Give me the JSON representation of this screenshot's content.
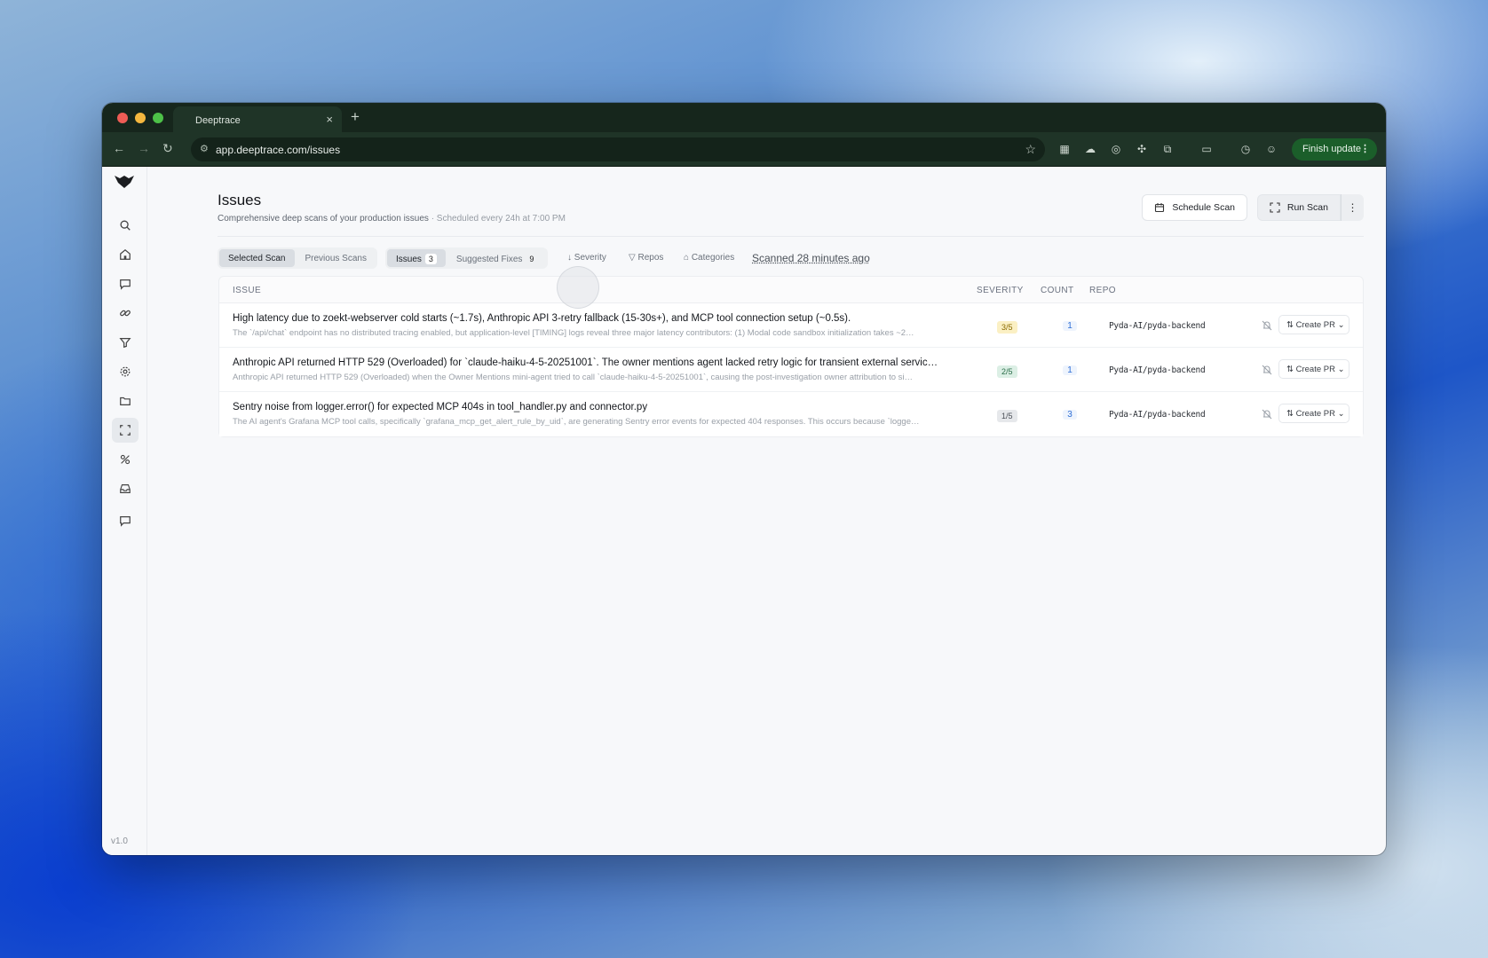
{
  "browser": {
    "tab_title": "Deeptrace",
    "url": "app.deeptrace.com/issues",
    "finish_update_label": "Finish update",
    "new_tab_glyph": "+",
    "close_glyph": "×"
  },
  "app": {
    "version": "v1.0"
  },
  "header": {
    "title": "Issues",
    "subtitle": "Comprehensive deep scans of your production issues",
    "schedule_note": "· Scheduled every 24h at 7:00 PM",
    "schedule_button": "Schedule Scan",
    "run_button": "Run Scan"
  },
  "filters": {
    "scan_tabs": [
      "Selected Scan",
      "Previous Scans"
    ],
    "issues_label": "Issues",
    "issues_count": "3",
    "fixes_label": "Suggested Fixes",
    "fixes_count": "9",
    "severity_label": "↓ Severity",
    "repos_label": "Repos",
    "categories_label": "Categories",
    "scanned_label": "Scanned 28 minutes ago"
  },
  "table": {
    "columns": [
      "ISSUE",
      "SEVERITY",
      "COUNT",
      "REPO"
    ],
    "rows": [
      {
        "title": "High latency due to zoekt-webserver cold starts (~1.7s), Anthropic API 3-retry fallback (15-30s+), and MCP tool connection setup (~0.5s).",
        "desc": "The `/api/chat` endpoint has no distributed tracing enabled, but application-level [TIMING] logs reveal three major latency contributors: (1) Modal code sandbox initialization takes ~2…",
        "severity": "3/5",
        "count": "1",
        "repo": "Pyda-AI/pyda-backend",
        "action": "Create PR"
      },
      {
        "title": "Anthropic API returned HTTP 529 (Overloaded) for `claude-haiku-4-5-20251001`. The owner mentions agent lacked retry logic for transient external servic…",
        "desc": "Anthropic API returned HTTP 529 (Overloaded) when the Owner Mentions mini-agent tried to call `claude-haiku-4-5-20251001`, causing the post-investigation owner attribution to si…",
        "severity": "2/5",
        "count": "1",
        "repo": "Pyda-AI/pyda-backend",
        "action": "Create PR"
      },
      {
        "title": "Sentry noise from logger.error() for expected MCP 404s in tool_handler.py and connector.py",
        "desc": "The AI agent's Grafana MCP tool calls, specifically `grafana_mcp_get_alert_rule_by_uid`, are generating Sentry error events for expected 404 responses. This occurs because `logge…",
        "severity": "1/5",
        "count": "3",
        "repo": "Pyda-AI/pyda-backend",
        "action": "Create PR"
      }
    ]
  },
  "colors": {
    "severity_3": "#fbf0c4",
    "severity_2": "#dcefe5",
    "severity_1": "#e6e8eb"
  }
}
